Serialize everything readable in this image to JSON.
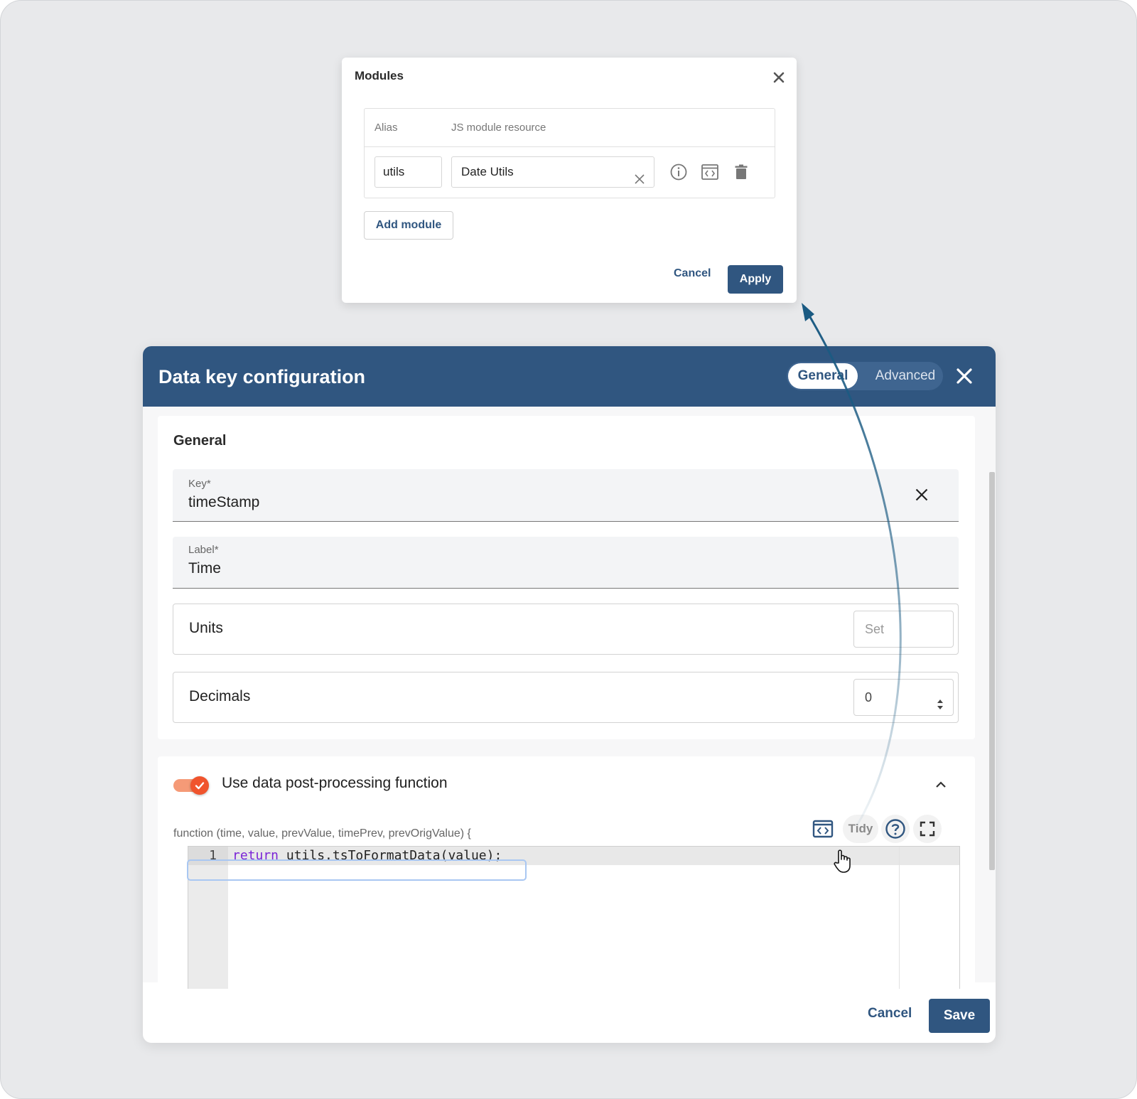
{
  "modules_dialog": {
    "title": "Modules",
    "columns": {
      "alias": "Alias",
      "resource": "JS module resource"
    },
    "row": {
      "alias": "utils",
      "resource": "Date Utils"
    },
    "add_module_label": "Add module",
    "cancel_label": "Cancel",
    "apply_label": "Apply"
  },
  "data_key_dialog": {
    "title": "Data key configuration",
    "tabs": [
      {
        "label": "General"
      },
      {
        "label": "Advanced"
      }
    ],
    "general": {
      "section_title": "General",
      "key": {
        "label": "Key*",
        "value": "timeStamp"
      },
      "label_field": {
        "label": "Label*",
        "value": "Time"
      },
      "units": {
        "label": "Units",
        "placeholder": "Set"
      },
      "decimals": {
        "label": "Decimals",
        "value": "0"
      }
    },
    "post_processing": {
      "toggle_label": "Use data post-processing function",
      "enabled": true,
      "signature": "function (time, value, prevValue, timePrev, prevOrigValue) {",
      "tidy_label": "Tidy",
      "code": {
        "line_number": "1",
        "keyword": "return",
        "rest": " utils.tsToFormatData(value);"
      }
    },
    "cancel_label": "Cancel",
    "save_label": "Save"
  },
  "colors": {
    "primary": "#305680",
    "toggle": "#f0542d",
    "background": "#e8e9eb"
  }
}
